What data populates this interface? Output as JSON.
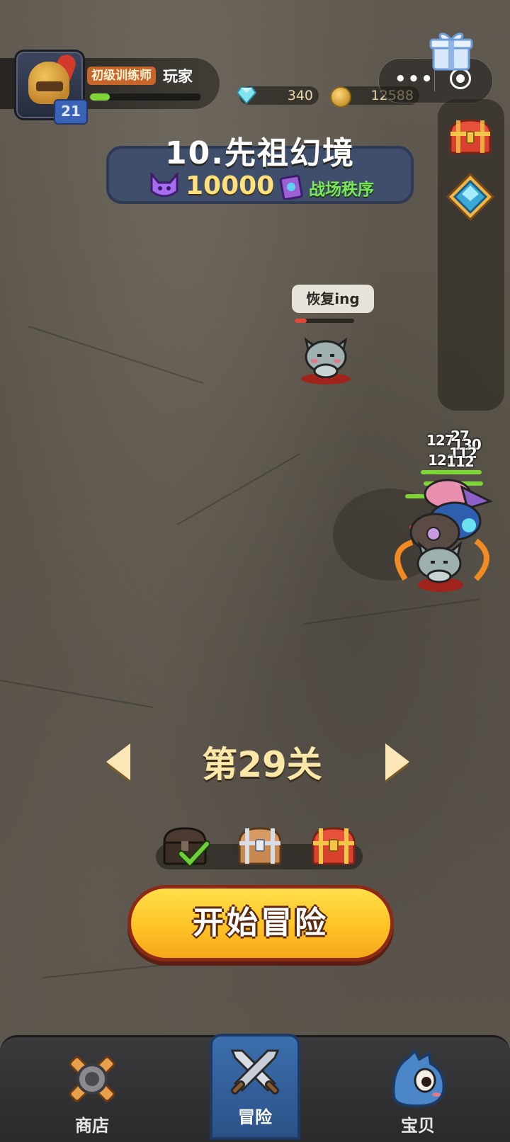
{
  "player": {
    "rank": "初级训练师",
    "name": "玩家",
    "level": "21",
    "xp_fraction": 0.18
  },
  "currency": {
    "gems": "340",
    "coins": "12588"
  },
  "stage": {
    "title": "10.先祖幻境",
    "power": "10000",
    "rule_link": "战场秩序"
  },
  "battle": {
    "enemy_status": "恢复ing",
    "damage_numbers": [
      "127",
      "27",
      "130",
      "112",
      "121",
      "112"
    ]
  },
  "level_select": {
    "label": "第29关"
  },
  "start_button": {
    "label": "开始冒险"
  },
  "nav": {
    "shop": "商店",
    "adventure": "冒险",
    "pets": "宝贝"
  },
  "colors": {
    "accent_gold": "#ffc326",
    "rule_green": "#7be65a",
    "banner_blue": "#3f4e6b",
    "nav_active": "#2b5187"
  },
  "icons": {
    "avatar": "helmet-icon",
    "gem": "diamond-icon",
    "coin": "coin-icon",
    "gift": "gift-icon",
    "power": "demon-horns-icon",
    "rule": "book-icon",
    "shop": "gear-shop-icon",
    "adventure": "crossed-swords-icon",
    "pets": "dragon-pet-icon"
  }
}
